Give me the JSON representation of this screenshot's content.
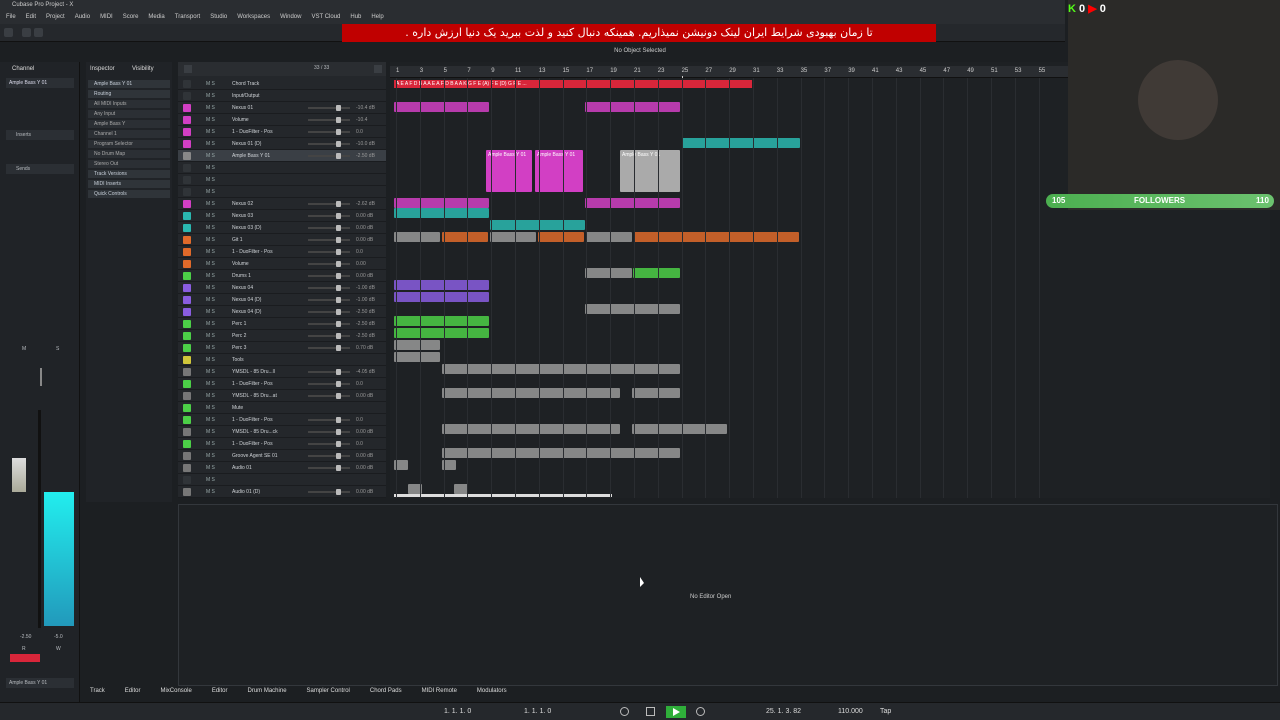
{
  "window": {
    "title": "Cubase Pro Project - X"
  },
  "menu": [
    "File",
    "Edit",
    "Project",
    "Audio",
    "MIDI",
    "Score",
    "Media",
    "Transport",
    "Studio",
    "Workspaces",
    "Window",
    "VST Cloud",
    "Hub",
    "Help"
  ],
  "banner": {
    "text": "تا زمان بهبودی شرایط ایران لینک دونیشن نمیذاریم. همینکه دنبال کنید و لذت ببرید یک دنیا ارزش داره ."
  },
  "status": {
    "selection": "No Object Selected"
  },
  "left_zone": {
    "tabs": [
      "Channel"
    ],
    "channel_name": "Ample Bass Y 01",
    "sections": [
      "Inserts",
      "Sends"
    ],
    "fader_labels": [
      "M",
      "S"
    ],
    "fader_db_left": "-2.50",
    "fader_db_right": "-5.0",
    "rw": [
      "R",
      "W"
    ],
    "footer_name": "Ample Bass Y 01"
  },
  "inspector": {
    "tabs": [
      "Inspector",
      "Visibility"
    ],
    "track_name": "Ample Bass Y 01",
    "rows": [
      "Routing",
      "All MIDI Inputs",
      "Any Input",
      "Ample Bass Y",
      "Channel 1",
      "Program Selector",
      "No Drum Map",
      "Stereo Out",
      "Track Versions",
      "MIDI Inserts",
      "Quick Controls"
    ]
  },
  "tracklist": {
    "header_count": "33 / 33",
    "tracks": [
      {
        "name": "Chord Track",
        "color": "#303438",
        "db": ""
      },
      {
        "name": "Input/Output",
        "color": "#303438",
        "db": ""
      },
      {
        "name": "Nexus 01",
        "color": "#d23fc4",
        "db": "-10.4 dB"
      },
      {
        "name": "Volume",
        "color": "#d23fc4",
        "db": "-10.4"
      },
      {
        "name": "1 - DuoFilter - Pos",
        "color": "#d23fc4",
        "db": "0.0"
      },
      {
        "name": "Nexus 01 (D)",
        "color": "#d23fc4",
        "db": "-10.0 dB"
      },
      {
        "name": "Ample Bass Y 01",
        "color": "#888",
        "db": "-2.50 dB"
      },
      {
        "name": "",
        "color": "#303438",
        "db": ""
      },
      {
        "name": "",
        "color": "#303438",
        "db": ""
      },
      {
        "name": "",
        "color": "#303438",
        "db": ""
      },
      {
        "name": "Nexus 02",
        "color": "#d23fc4",
        "db": "-2.62 dB"
      },
      {
        "name": "Nexus 03",
        "color": "#2ab8b0",
        "db": "0.00 dB"
      },
      {
        "name": "Nexus 03 (D)",
        "color": "#2ab8b0",
        "db": "0.00 dB"
      },
      {
        "name": "Git 1",
        "color": "#e06a2a",
        "db": "0.00 dB"
      },
      {
        "name": "1 - DuoFilter - Pos",
        "color": "#e06a2a",
        "db": "0.0"
      },
      {
        "name": "Volume",
        "color": "#e06a2a",
        "db": "0.00"
      },
      {
        "name": "Drums 1",
        "color": "#4ccf47",
        "db": "0.00 dB"
      },
      {
        "name": "Nexus 04",
        "color": "#8a5de0",
        "db": "-1.00 dB"
      },
      {
        "name": "Nexus 04 (D)",
        "color": "#8a5de0",
        "db": "-1.00 dB"
      },
      {
        "name": "Nexus 04 (D)",
        "color": "#8a5de0",
        "db": "-2.50 dB"
      },
      {
        "name": "Perc 1",
        "color": "#4ccf47",
        "db": "-2.50 dB"
      },
      {
        "name": "Perc 2",
        "color": "#4ccf47",
        "db": "-2.50 dB"
      },
      {
        "name": "Perc 3",
        "color": "#4ccf47",
        "db": "0.70 dB"
      },
      {
        "name": "Tools",
        "color": "#d0c73a",
        "db": ""
      },
      {
        "name": "YMSDL - 85 Dru...ll",
        "color": "#777",
        "db": "-4.05 dB"
      },
      {
        "name": "1 - DuoFilter - Pos",
        "color": "#4ccf47",
        "db": "0.0"
      },
      {
        "name": "YMSDL - 85 Dru...at",
        "color": "#777",
        "db": "0.00 dB"
      },
      {
        "name": "Mute",
        "color": "#4ccf47",
        "db": ""
      },
      {
        "name": "1 - DuoFilter - Pos",
        "color": "#4ccf47",
        "db": "0.0"
      },
      {
        "name": "YMSDL - 85 Dru...ck",
        "color": "#777",
        "db": "0.00 dB"
      },
      {
        "name": "1 - DuoFilter - Pos",
        "color": "#4ccf47",
        "db": "0.0"
      },
      {
        "name": "Groove Agent SE 01",
        "color": "#777",
        "db": "0.00 dB"
      },
      {
        "name": "Audio 01",
        "color": "#777",
        "db": "0.00 dB"
      },
      {
        "name": "",
        "color": "#303438",
        "db": ""
      },
      {
        "name": "Audio 01 (D)",
        "color": "#777",
        "db": "0.00 dB"
      }
    ]
  },
  "ruler": {
    "bars": [
      "1",
      "3",
      "5",
      "7",
      "9",
      "11",
      "13",
      "15",
      "17",
      "19",
      "21",
      "23",
      "25",
      "27",
      "29",
      "31",
      "33",
      "35",
      "37",
      "39",
      "41",
      "43",
      "45",
      "47",
      "49",
      "51",
      "53",
      "55"
    ]
  },
  "chord_clip": {
    "text": "A E A F D B A A E A F D B A A K G F E (A) F E (D) G F E ..."
  },
  "clips": [
    {
      "label": "Ample Bass Y 01",
      "track": "ample"
    },
    {
      "label": "Ample Bass Y 01",
      "track": "ample"
    },
    {
      "label": "Ample Bass Y 01",
      "track": "ample"
    }
  ],
  "lower_zone": {
    "message": "No Editor Open"
  },
  "bottom_tabs": [
    "Track",
    "Editor",
    "MixConsole",
    "Editor",
    "Drum Machine",
    "Sampler Control",
    "Chord Pads",
    "MIDI Remote",
    "Modulators"
  ],
  "transport": {
    "left_locator": "1. 1. 1. 0",
    "right_locator": "1. 1. 1. 0",
    "position": "25. 1. 3. 82",
    "tempo": "110.000",
    "tap": "Tap"
  },
  "stream": {
    "kick_counts": [
      "0",
      "0"
    ],
    "followers_current": "105",
    "followers_label": "FOLLOWERS",
    "followers_goal": "110",
    "followers_progress": 0.95
  },
  "colors": {
    "magenta": "#d23fc4",
    "cyan": "#2ab8b0",
    "orange": "#e06a2a",
    "green": "#4ccf47",
    "purple": "#8a5de0",
    "banner": "#c00000"
  }
}
